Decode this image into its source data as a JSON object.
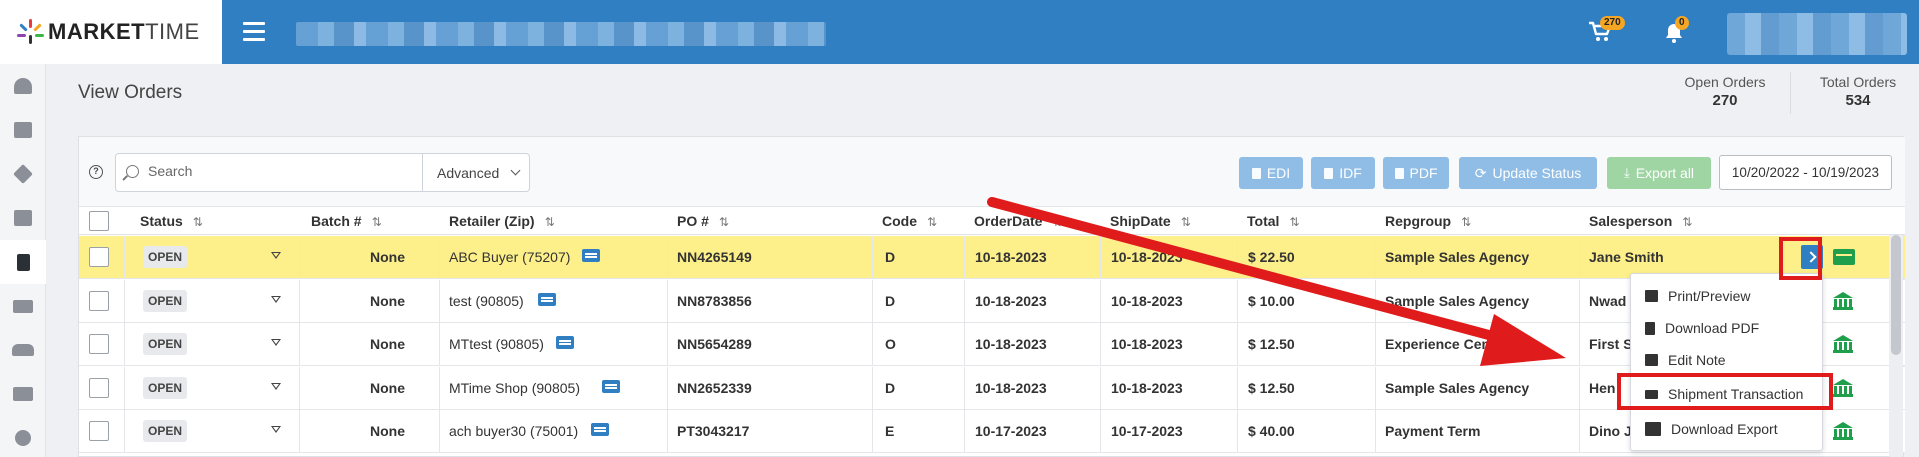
{
  "brand": {
    "name_bold": "MARKET",
    "name_light": "TIME"
  },
  "header": {
    "cart_count": "270",
    "notification_count": "0"
  },
  "page": {
    "title": "View Orders",
    "stats": [
      {
        "label": "Open Orders",
        "value": "270"
      },
      {
        "label": "Total Orders",
        "value": "534"
      }
    ]
  },
  "toolbar": {
    "search_placeholder": "Search",
    "advanced_label": "Advanced",
    "buttons": {
      "edi": "EDI",
      "idf": "IDF",
      "pdf": "PDF",
      "update_status": "Update Status",
      "export_all": "Export all"
    },
    "date_range": "10/20/2022 - 10/19/2023"
  },
  "table": {
    "columns": [
      "Status",
      "Batch #",
      "Retailer (Zip)",
      "PO #",
      "Code",
      "OrderDate",
      "ShipDate",
      "Total",
      "Repgroup",
      "Salesperson"
    ],
    "rows": [
      {
        "status": "OPEN",
        "batch": "None",
        "retailer": "ABC Buyer (75207)",
        "po": "NN4265149",
        "code": "D",
        "order_date": "10-18-2023",
        "ship_date": "10-18-2023",
        "total": "$ 22.50",
        "repgroup": "Sample Sales Agency",
        "salesperson": "Jane Smith"
      },
      {
        "status": "OPEN",
        "batch": "None",
        "retailer": "test (90805)",
        "po": "NN8783856",
        "code": "D",
        "order_date": "10-18-2023",
        "ship_date": "10-18-2023",
        "total": "$ 10.00",
        "repgroup": "Sample Sales Agency",
        "salesperson": "Nwad"
      },
      {
        "status": "OPEN",
        "batch": "None",
        "retailer": "MTtest (90805)",
        "po": "NN5654289",
        "code": "O",
        "order_date": "10-18-2023",
        "ship_date": "10-18-2023",
        "total": "$ 12.50",
        "repgroup": "Experience Center",
        "salesperson": "First S"
      },
      {
        "status": "OPEN",
        "batch": "None",
        "retailer": "MTime Shop (90805)",
        "po": "NN2652339",
        "code": "D",
        "order_date": "10-18-2023",
        "ship_date": "10-18-2023",
        "total": "$ 12.50",
        "repgroup": "Sample Sales Agency",
        "salesperson": "Hen"
      },
      {
        "status": "OPEN",
        "batch": "None",
        "retailer": "ach buyer30 (75001)",
        "po": "PT3043217",
        "code": "E",
        "order_date": "10-17-2023",
        "ship_date": "10-17-2023",
        "total": "$ 40.00",
        "repgroup": "Payment Term",
        "salesperson": "Dino J"
      }
    ]
  },
  "row_menu": {
    "items": [
      "Print/Preview",
      "Download PDF",
      "Edit Note",
      "Shipment Transaction",
      "Download Export"
    ]
  },
  "colors": {
    "brand_blue": "#2f7fc2",
    "highlight_yellow": "#fdf08a",
    "annotation_red": "#e01b1b",
    "green": "#1f9e4b"
  }
}
